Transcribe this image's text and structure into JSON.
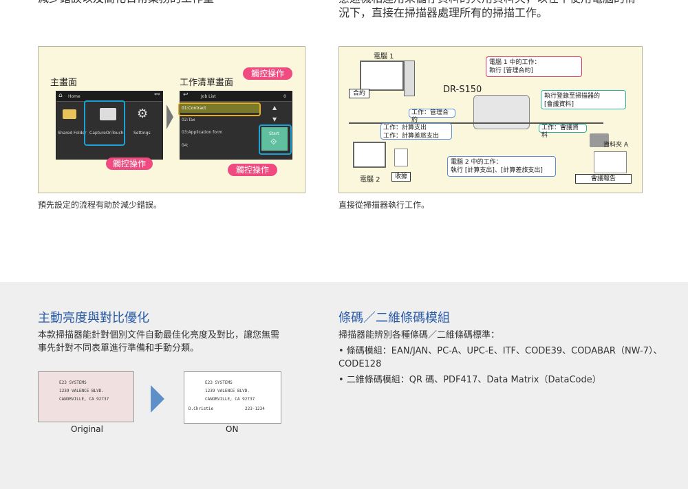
{
  "top": {
    "left_text": "減少錯誤以及簡化日常業務的工作量",
    "right_text_line1": "意遠機相連用來儲存資料的共用資料夾，以在不使用電腦的情",
    "right_text_line2": "況下，直接在掃描器處理所有的掃描工作。"
  },
  "left_panel": {
    "main_title": "主畫面",
    "job_title": "工作清單畫面",
    "home_label": "Home",
    "icons": [
      "Shared Folder",
      "CaptureOnTouch",
      "Settings"
    ],
    "job_list_header": "Job List",
    "job_list_count": "0",
    "jobs": [
      "01:Contract",
      "02:Tax",
      "03:Application form",
      "04:"
    ],
    "start_label": "Start",
    "bubbles": [
      "觸控操作",
      "觸控操作",
      "觸控操作"
    ],
    "caption": "預先設定的流程有助於減少錯誤。"
  },
  "right_panel": {
    "pc1": "電腦 1",
    "pc2": "電腦 2",
    "model": "DR-S150",
    "contract": "合約",
    "receipt": "收據",
    "pc1_job_line1": "電腦 1 中的工作：",
    "pc1_job_line2": "執行 [管理合約]",
    "job_manage": "工作：管理合約",
    "job_calc_line1": "工作：計算支出",
    "job_calc_line2": "工作：計算差旅支出",
    "job_meeting": "工作：會議資料",
    "register_line1": "執行登錄至掃描器的",
    "register_line2": "[會議資料]",
    "pc2_job_line1": "電腦 2 中的工作：",
    "pc2_job_line2": "執行 [計算支出]、[計算差旅支出]",
    "folder_a": "資料夾 A",
    "meeting_report": "會議報告",
    "caption": "直接從掃描器執行工作。"
  },
  "bottom_left": {
    "heading": "主動亮度與對比優化",
    "body_line1": "本款掃描器能針對個別文件自動最佳化亮度及對比，讓您無需",
    "body_line2": "事先針對不同表單進行準備和手動分類。",
    "label_original": "Original",
    "label_on": "ON",
    "check_line1": "E23 SYSTEMS",
    "check_line2": "1239 VALENCE BLVD.",
    "check_line3": "CANORVILLE, CA 92737",
    "check_amount": "223-1234",
    "check_sign": "D.Christie"
  },
  "bottom_right": {
    "heading": "條碼／二維條碼模組",
    "intro": "掃描器能辨別各種條碼／二維條碼標準：",
    "bullet1": "• 條碼模組：EAN/JAN、PC-A、UPC-E、ITF、CODE39、CODABAR（NW-7）、",
    "bullet1_cont": "CODE128",
    "bullet2": "• 二維條碼模組：QR 碼、PDF417、Data Matrix（DataCode）"
  }
}
